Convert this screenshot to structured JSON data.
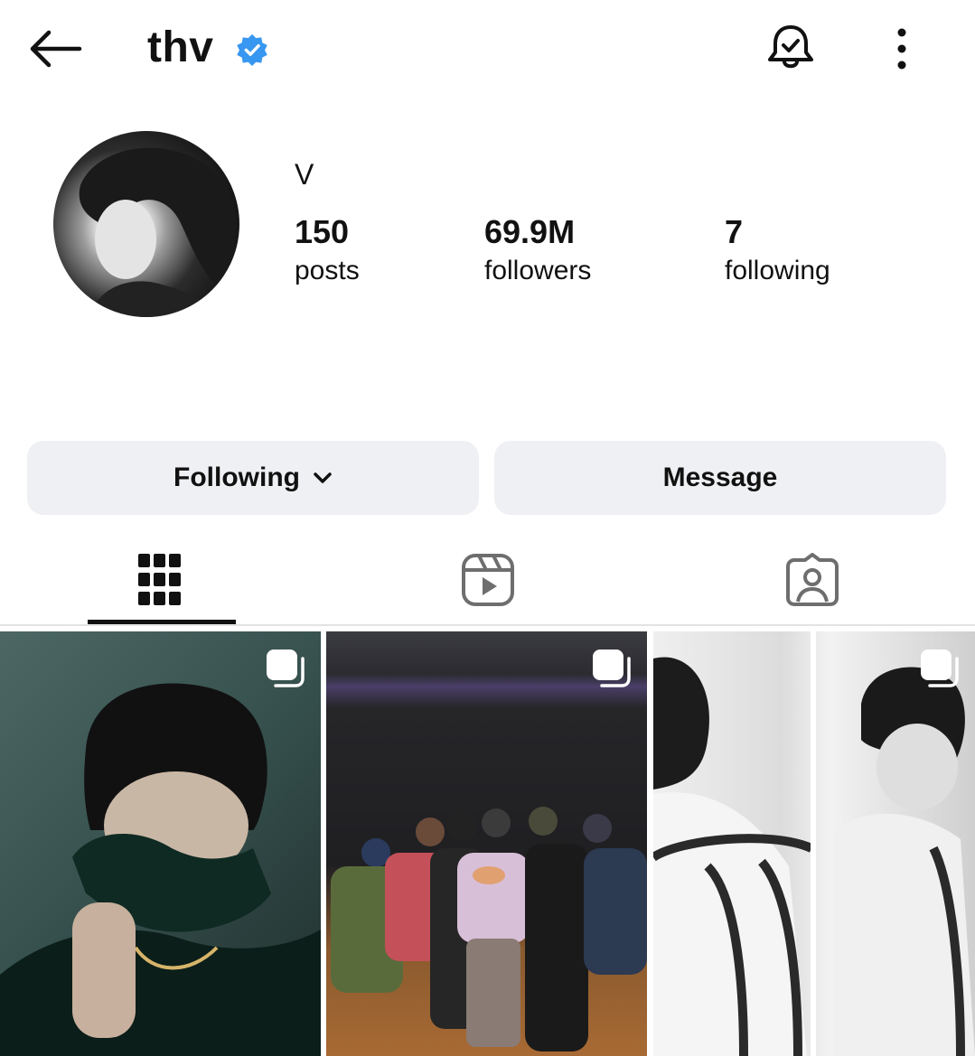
{
  "header": {
    "username": "thv",
    "back_icon": "arrow-left-icon",
    "verified_icon": "verified-badge-icon",
    "verified_color": "#3897f0",
    "notification_icon": "bell-check-icon",
    "more_icon": "more-vertical-icon"
  },
  "profile": {
    "display_name": "V",
    "stats": [
      {
        "value": "150",
        "label": "posts"
      },
      {
        "value": "69.9M",
        "label": "followers"
      },
      {
        "value": "7",
        "label": "following"
      }
    ]
  },
  "actions": {
    "following_label": "Following",
    "message_label": "Message"
  },
  "tabs": [
    {
      "name": "grid",
      "icon": "grid-icon",
      "selected": true
    },
    {
      "name": "reels",
      "icon": "reels-icon",
      "selected": false
    },
    {
      "name": "tagged",
      "icon": "tagged-person-icon",
      "selected": false
    }
  ],
  "posts": [
    {
      "type": "carousel",
      "icon": "carousel-icon"
    },
    {
      "type": "carousel",
      "icon": "carousel-icon"
    },
    {
      "type": "carousel",
      "icon": "carousel-icon"
    }
  ]
}
